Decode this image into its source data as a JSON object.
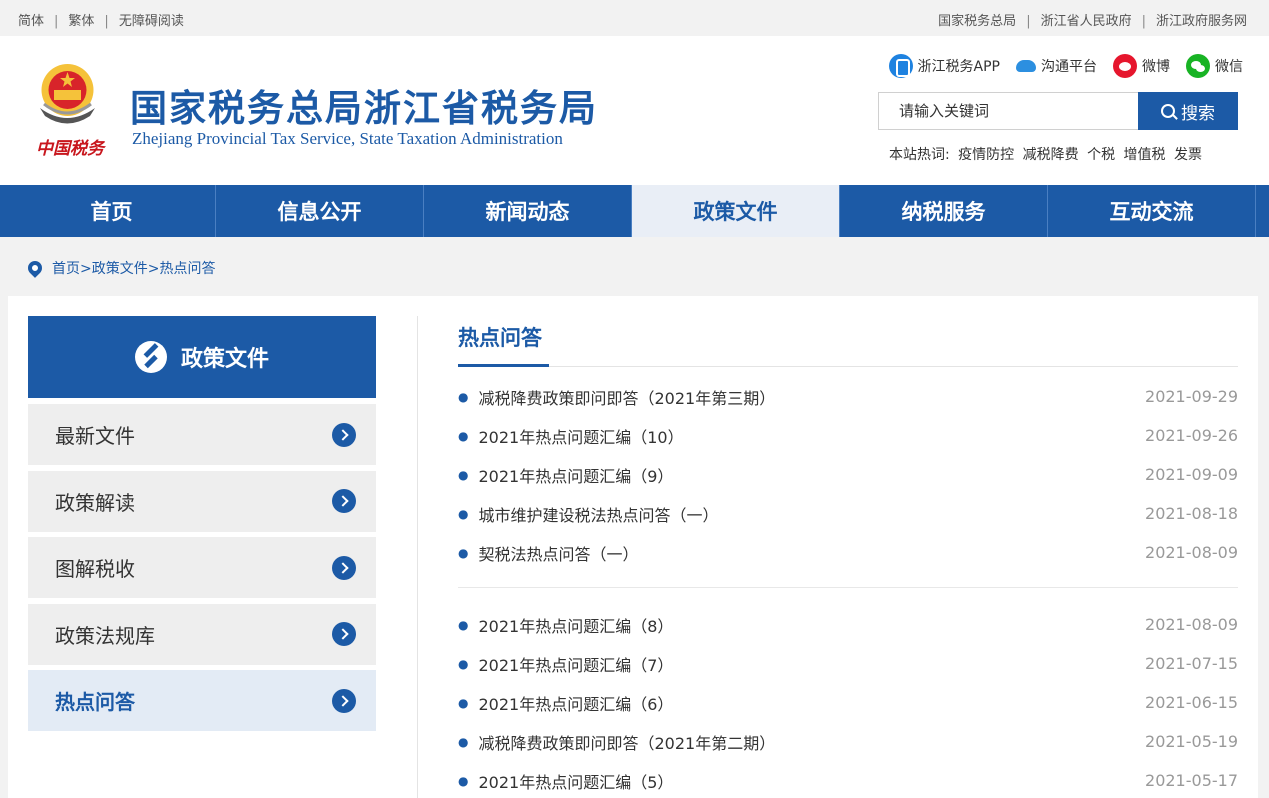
{
  "topbar": {
    "left": [
      "简体",
      "繁体",
      "无障碍阅读"
    ],
    "right": [
      "国家税务总局",
      "浙江省人民政府",
      "浙江政府服务网"
    ],
    "sep": "|"
  },
  "header": {
    "emblem_text": "中国税务",
    "title": "国家税务总局浙江省税务局",
    "subtitle": "Zhejiang Provincial Tax Service, State Taxation Administration",
    "links": [
      {
        "label": "浙江税务APP",
        "icon": "app-icon"
      },
      {
        "label": "沟通平台",
        "icon": "cloud-icon"
      },
      {
        "label": "微博",
        "icon": "weibo-icon"
      },
      {
        "label": "微信",
        "icon": "wechat-icon"
      }
    ],
    "search": {
      "placeholder": "请输入关键词",
      "button": "搜索"
    },
    "hot_label": "本站热词:",
    "hot_words": [
      "疫情防控",
      "减税降费",
      "个税",
      "增值税",
      "发票"
    ]
  },
  "nav": [
    "首页",
    "信息公开",
    "新闻动态",
    "政策文件",
    "纳税服务",
    "互动交流"
  ],
  "nav_active": "政策文件",
  "breadcrumb": "首页>政策文件>热点问答",
  "sidebar": {
    "title": "政策文件",
    "items": [
      "最新文件",
      "政策解读",
      "图解税收",
      "政策法规库",
      "热点问答"
    ],
    "active": "热点问答"
  },
  "main": {
    "title": "热点问答",
    "group1": [
      {
        "title": "减税降费政策即问即答（2021年第三期）",
        "date": "2021-09-29"
      },
      {
        "title": "2021年热点问题汇编（10）",
        "date": "2021-09-26"
      },
      {
        "title": "2021年热点问题汇编（9）",
        "date": "2021-09-09"
      },
      {
        "title": "城市维护建设税法热点问答（一）",
        "date": "2021-08-18"
      },
      {
        "title": "契税法热点问答（一）",
        "date": "2021-08-09"
      }
    ],
    "group2": [
      {
        "title": "2021年热点问题汇编（8）",
        "date": "2021-08-09"
      },
      {
        "title": "2021年热点问题汇编（7）",
        "date": "2021-07-15"
      },
      {
        "title": "2021年热点问题汇编（6）",
        "date": "2021-06-15"
      },
      {
        "title": "减税降费政策即问即答（2021年第二期）",
        "date": "2021-05-19"
      },
      {
        "title": "2021年热点问题汇编（5）",
        "date": "2021-05-17"
      }
    ]
  },
  "colors": {
    "brand": "#1c5aa6",
    "emblem_red": "#c8161d"
  }
}
